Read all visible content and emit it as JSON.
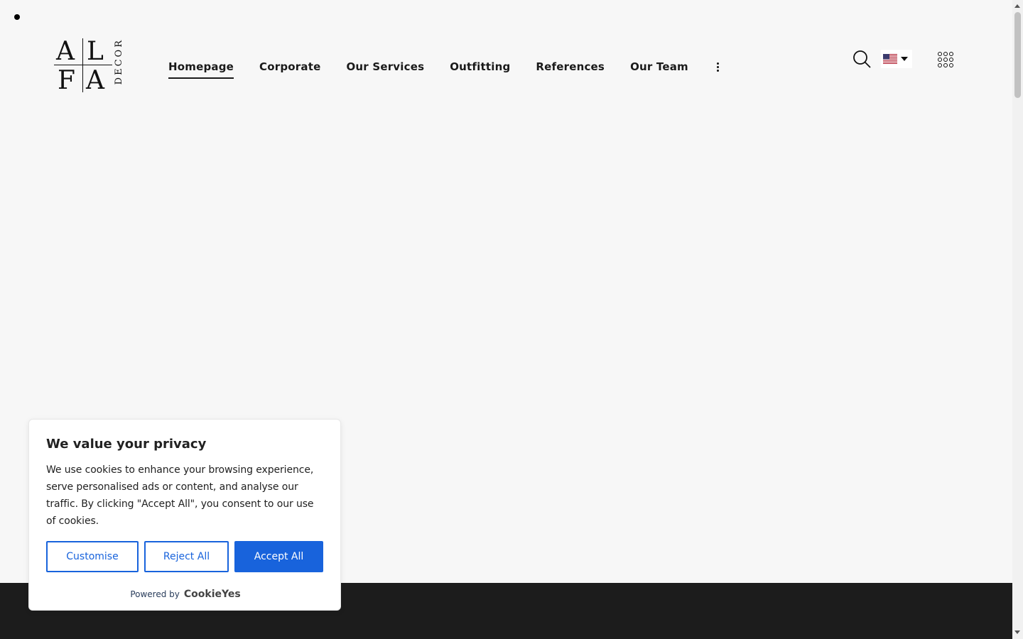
{
  "brand": {
    "letters": [
      "A",
      "L",
      "F",
      "A"
    ],
    "tagline": "DECOR"
  },
  "nav": {
    "items": [
      {
        "label": "Homepage"
      },
      {
        "label": "Corporate"
      },
      {
        "label": "Our Services"
      },
      {
        "label": "Outfitting"
      },
      {
        "label": "References"
      },
      {
        "label": "Our Team"
      }
    ],
    "active_index": 0
  },
  "tools": {
    "search_icon": "search-icon",
    "language_icon": "us-flag-icon",
    "menu_icon": "apps-grid-icon"
  },
  "cookie": {
    "title": "We value your privacy",
    "body": "We use cookies to enhance your browsing experience, serve personalised ads or content, and analyse our traffic. By clicking \"Accept All\", you consent to our use of cookies.",
    "customise_label": "Customise",
    "reject_label": "Reject All",
    "accept_label": "Accept All",
    "powered_by": "Powered by",
    "powered_brand": "CookieYes"
  },
  "colors": {
    "accent": "#1863dc",
    "background": "#f7f7f7",
    "footer": "#1c1c1c"
  }
}
